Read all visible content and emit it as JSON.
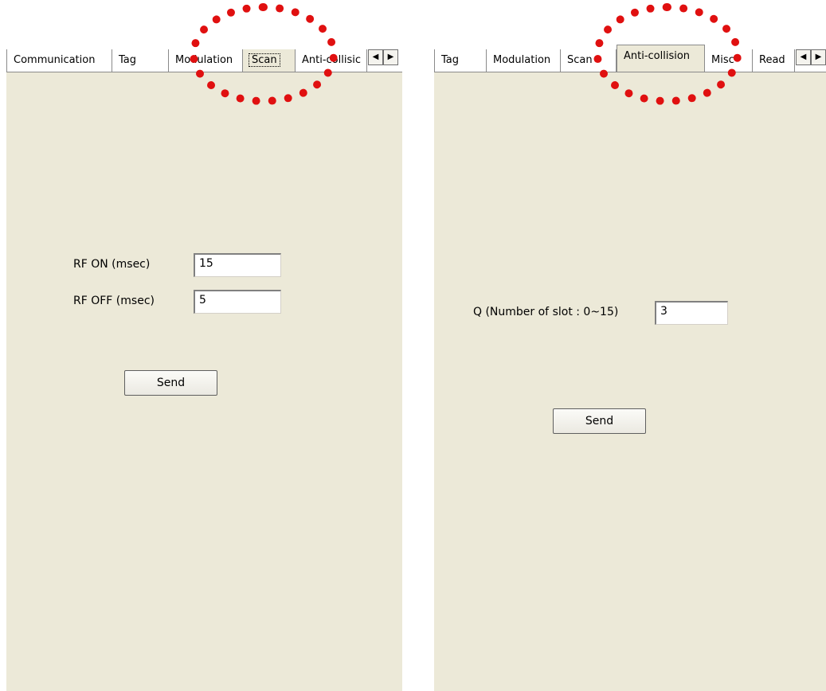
{
  "left": {
    "tabs": [
      "Communication",
      "Tag",
      "Modulation",
      "Scan",
      "Anti-collisic"
    ],
    "selected_tab": "Scan",
    "rf_on_label": "RF ON  (msec)",
    "rf_on_value": "15",
    "rf_off_label": "RF OFF  (msec)",
    "rf_off_value": "5",
    "send_label": "Send",
    "scroll_left": "◀",
    "scroll_right": "▶"
  },
  "right": {
    "tabs": [
      "Tag",
      "Modulation",
      "Scan",
      "Anti-collision",
      "Misc",
      "Read"
    ],
    "selected_tab": "Anti-collision",
    "q_label": "Q  (Number of slot : 0~15)",
    "q_value": "3",
    "send_label": "Send",
    "scroll_left": "◀",
    "scroll_right": "▶"
  },
  "colors": {
    "panel": "#ece9d8",
    "annotation": "#e01010"
  }
}
